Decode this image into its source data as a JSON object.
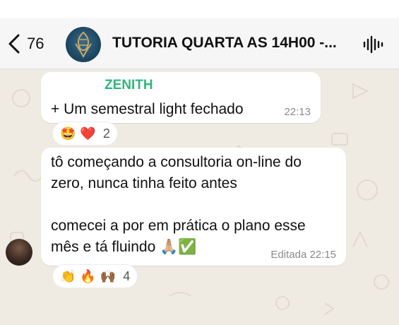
{
  "header": {
    "back_count": "76",
    "title": "TUTORIA QUARTA AS 14H00 -...",
    "icons": [
      "back-arrow-icon",
      "group-avatar",
      "audio-wave-icon"
    ]
  },
  "messages": [
    {
      "sender": "ZENITH",
      "sender_color": "#2fb57a",
      "text": "+ Um semestral light fechado",
      "time": "22:13",
      "reactions": {
        "emojis": [
          "🤩",
          "❤️"
        ],
        "count": "2"
      }
    },
    {
      "lines": [
        "tô começando a consultoria on-line do",
        "zero, nunca tinha feito antes",
        "",
        "comecei a por em prática o plano esse",
        "mês e tá fluindo 🙏🏼✅"
      ],
      "time": "Editada 22:15",
      "reactions": {
        "emojis": [
          "👏",
          "🔥",
          "🙌🏾"
        ],
        "count": "4"
      }
    }
  ],
  "colors": {
    "header_bg": "#f6f6f6",
    "chat_bg": "#efeae2",
    "bubble_bg": "#ffffff",
    "accent": "#2fb57a"
  }
}
